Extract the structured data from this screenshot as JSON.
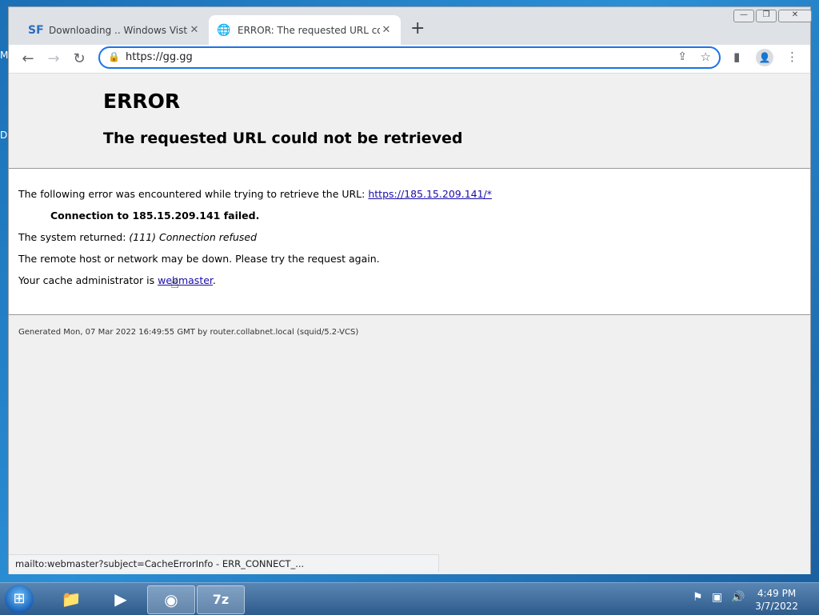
{
  "desktop": {
    "edge_labels": [
      "M",
      "D"
    ]
  },
  "browser": {
    "window_controls": {
      "minimize": "—",
      "restore": "❐",
      "close": "✕"
    },
    "tabs": [
      {
        "favicon": "SF",
        "title": "Downloading .. Windows Vista Tr",
        "active": false
      },
      {
        "favicon": "globe-icon",
        "title": "ERROR: The requested URL could",
        "active": true
      }
    ],
    "new_tab": "+",
    "address": "https://gg.gg"
  },
  "page": {
    "heading": "ERROR",
    "subheading": "The requested URL could not be retrieved",
    "line1_text": "The following error was encountered while trying to retrieve the URL: ",
    "line1_link": "https://185.15.209.141/*",
    "connection_failed": "Connection to 185.15.209.141 failed.",
    "system_returned_label": "The system returned: ",
    "system_returned_value": "(111) Connection refused",
    "remote_host_text": "The remote host or network may be down. Please try the request again.",
    "cache_admin_text": "Your cache administrator is ",
    "cache_admin_link": "webmaster",
    "cache_admin_suffix": ".",
    "footer": "Generated Mon, 07 Mar 2022 16:49:55 GMT by router.collabnet.local (squid/5.2-VCS)"
  },
  "status_bar": "mailto:webmaster?subject=CacheErrorInfo - ERR_CONNECT_...",
  "taskbar": {
    "apps": [
      "explorer-icon",
      "media-player-icon",
      "chrome-icon",
      "7zip-icon"
    ],
    "sevenzip_label": "7z",
    "time": "4:49 PM",
    "date": "3/7/2022"
  }
}
